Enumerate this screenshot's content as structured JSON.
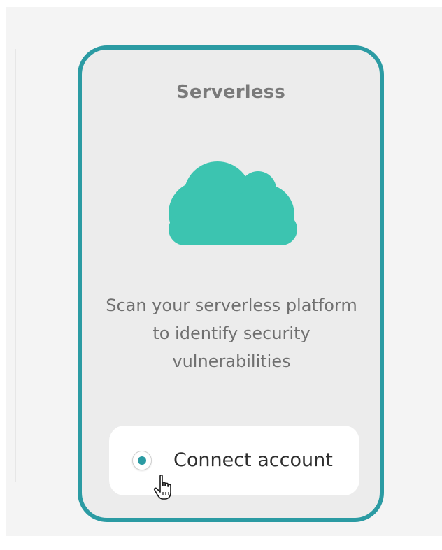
{
  "card": {
    "title": "Serverless",
    "icon": "cloud-icon",
    "description": "Scan your serverless platform to identify security vulnerabilities",
    "connect_label": "Connect account",
    "border_color": "#2b9ba3",
    "icon_color": "#3cc4b0",
    "background_color": "#ececec"
  },
  "cursor": "hand-pointer-icon"
}
